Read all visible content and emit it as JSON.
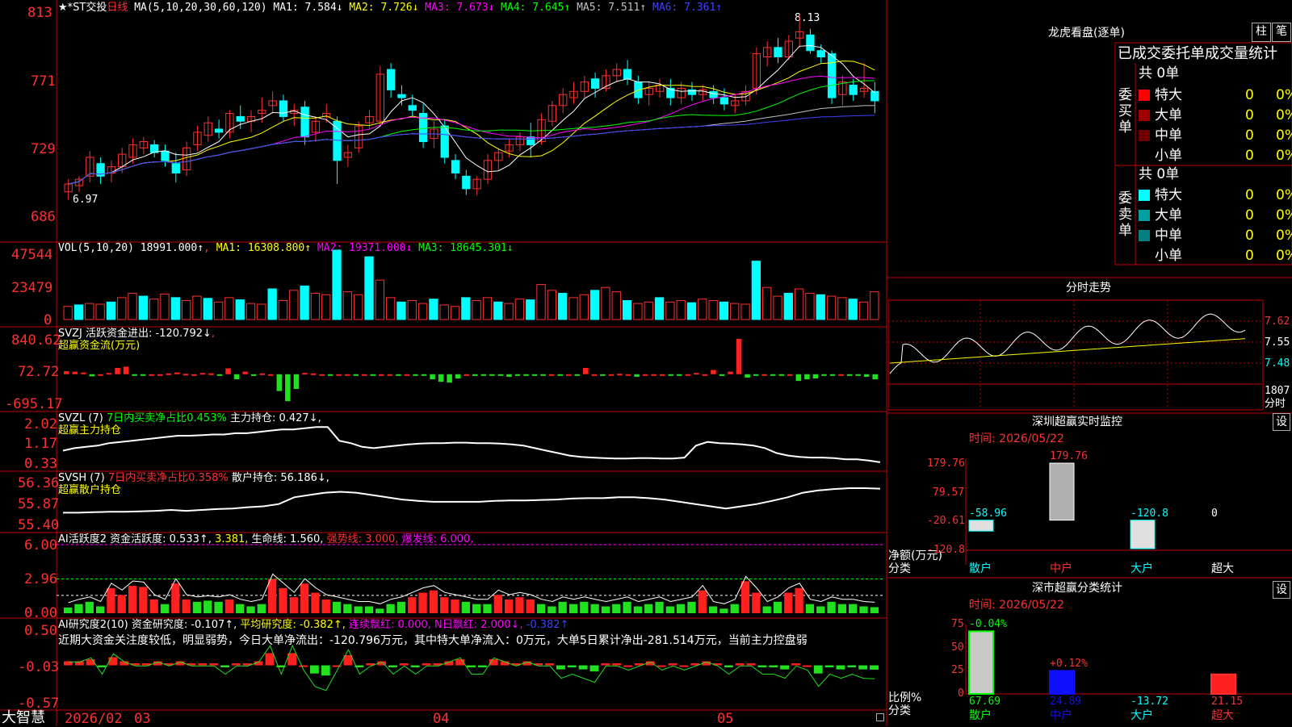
{
  "stock_title": "★*ST交投",
  "period": "日线",
  "ma_panel": {
    "label": "MA(5,10,20,30,60,120)",
    "items": [
      {
        "text": "MA1: 7.584↓",
        "color": "#ffffff"
      },
      {
        "text": "MA2: 7.726↓",
        "color": "#ffff00"
      },
      {
        "text": "MA3: 7.673↓",
        "color": "#ff00ff"
      },
      {
        "text": "MA4: 7.645↑",
        "color": "#00ff00"
      },
      {
        "text": "MA5: 7.511↑",
        "color": "#c0c0c0"
      },
      {
        "text": "MA6: 7.361↑",
        "color": "#4040ff"
      }
    ],
    "high_marker": "8.13",
    "low_marker": "6.97",
    "y_ticks": [
      "813",
      "771",
      "729",
      "686"
    ]
  },
  "vol_panel": {
    "label": "VOL(5,10,20)",
    "value": "18991.000↑",
    "items": [
      {
        "text": "MA1: 16308.800↑",
        "color": "#ffff00"
      },
      {
        "text": "MA2: 19371.000↓",
        "color": "#ff00ff"
      },
      {
        "text": "MA3: 18645.301↓",
        "color": "#00ff00"
      }
    ],
    "y_ticks": [
      "47544",
      "23479",
      "0"
    ]
  },
  "svzj_panel": {
    "label": "SVZJ",
    "line1": "活跃资金进出: -120.792↓",
    "line2": "超赢资金流(万元)",
    "y_ticks": [
      "840.62",
      "72.72",
      "-695.17"
    ]
  },
  "svzl_panel": {
    "label": "SVZL (7)",
    "ratio": "7日内买卖净占比0.453%",
    "holding": "主力持仓: 0.427↓,",
    "line2": "超赢主力持仓",
    "y_ticks": [
      "2.02",
      "1.17",
      "0.33"
    ]
  },
  "svsh_panel": {
    "label": "SVSH (7)",
    "ratio": "7日内买卖净占比0.358%",
    "holding": "散户持仓: 56.186↓,",
    "line2": "超赢散户持仓",
    "y_ticks": [
      "56.36",
      "55.87",
      "55.40"
    ]
  },
  "ai_active_panel": {
    "label": "AI活跃度2",
    "v1": "资金活跃度: 0.533↑,",
    "v2": "3.381,",
    "v3": "生命线: 1.560,",
    "v4": "强势线: 3.000,",
    "v5": "爆发线: 6.000,",
    "y_ticks": [
      "6.00",
      "2.96",
      "0.00"
    ]
  },
  "ai_research_panel": {
    "label": "AI研究度2(10)",
    "v1": "资金研究度: -0.107↑,",
    "v2": "平均研究度: -0.382↑,",
    "v3": "连续飘红: 0.000,",
    "v4": "N日飘红: 2.000↓,",
    "v5": "-0.382↑",
    "commentary": "近期大资金关注度较低，明显弱势，今日大单净流出：-120.796万元，其中特大单净流入：0万元，大单5日累计净出-281.514万元，当前主力控盘弱",
    "y_ticks": [
      "0.50",
      "-0.03",
      "-0.57"
    ]
  },
  "bottom_bar": {
    "brand": "大智慧",
    "dates": [
      "2026/02",
      "03",
      "04",
      "05"
    ]
  },
  "right_panel": {
    "dragon_title": "龙虎看盘(逐单)",
    "btn_bar": "柱",
    "btn_pen": "笔",
    "tabs": [
      "已成交",
      "委托单",
      "成交量统计"
    ],
    "buy_group": {
      "label": "委买单",
      "total": "共 0单",
      "rows": [
        {
          "name": "特大",
          "count": "0",
          "pct": "0%",
          "color": "#ff0000"
        },
        {
          "name": "大单",
          "count": "0",
          "pct": "0%",
          "color": "#a00000"
        },
        {
          "name": "中单",
          "count": "0",
          "pct": "0%",
          "color": "#700000"
        },
        {
          "name": "小单",
          "count": "0",
          "pct": "0%",
          "color": ""
        }
      ]
    },
    "sell_group": {
      "label": "委卖单",
      "total": "共 0单",
      "rows": [
        {
          "name": "特大",
          "count": "0",
          "pct": "0%",
          "color": "#00ffff"
        },
        {
          "name": "大单",
          "count": "0",
          "pct": "0%",
          "color": "#00a0a0"
        },
        {
          "name": "中单",
          "count": "0",
          "pct": "0%",
          "color": "#008080"
        },
        {
          "name": "小单",
          "count": "0",
          "pct": "0%",
          "color": ""
        }
      ]
    },
    "intraday": {
      "title": "分时走势",
      "y_ticks": [
        "7.62",
        "7.55",
        "7.48"
      ],
      "vol_tick": "1807",
      "vol_label": "分时"
    },
    "monitor": {
      "title": "深圳超赢实时监控",
      "btn": "设",
      "time_label": "时间:",
      "time": "2026/05/22",
      "y_ticks": [
        "179.76",
        "79.57",
        "-20.61",
        "-120.8"
      ],
      "y_label": "净额(万元)",
      "x_label": "分类",
      "categories": [
        "散户",
        "中户",
        "大户",
        "超大"
      ],
      "values": [
        -58.96,
        179.76,
        -120.8,
        0
      ],
      "value_labels": [
        "-58.96",
        "179.76",
        "-120.8",
        "0"
      ]
    },
    "stats": {
      "title": "深市超赢分类统计",
      "btn": "设",
      "time_label": "时间:",
      "time": "2026/05/22",
      "y_ticks": [
        "75",
        "50",
        "25",
        "0"
      ],
      "y_label": "比例%",
      "x_label": "分类",
      "categories": [
        "散户",
        "中户",
        "大户",
        "超大"
      ],
      "values": [
        67.69,
        24.89,
        -13.72,
        21.15
      ],
      "value_labels": [
        "67.69",
        "24.89",
        "-13.72",
        "21.15"
      ],
      "change_labels": [
        "-0.04%",
        "+0.12%",
        "",
        ""
      ]
    }
  },
  "chart_data": [
    {
      "type": "candlestick",
      "title": "★*ST交投 日线",
      "ylim": [
        6.86,
        8.13
      ],
      "high": 8.13,
      "low": 6.97,
      "x_ticks": [
        "2026/02",
        "03",
        "04",
        "05"
      ],
      "ohlc": [
        [
          7.0,
          7.08,
          6.95,
          7.05
        ],
        [
          7.04,
          7.1,
          7.0,
          7.08
        ],
        [
          7.1,
          7.26,
          7.06,
          7.22
        ],
        [
          7.18,
          7.22,
          7.05,
          7.1
        ],
        [
          7.12,
          7.2,
          7.06,
          7.16
        ],
        [
          7.16,
          7.28,
          7.12,
          7.24
        ],
        [
          7.22,
          7.34,
          7.18,
          7.3
        ],
        [
          7.28,
          7.35,
          7.24,
          7.32
        ],
        [
          7.3,
          7.33,
          7.22,
          7.25
        ],
        [
          7.26,
          7.3,
          7.16,
          7.2
        ],
        [
          7.18,
          7.25,
          7.06,
          7.12
        ],
        [
          7.14,
          7.32,
          7.1,
          7.28
        ],
        [
          7.3,
          7.42,
          7.26,
          7.38
        ],
        [
          7.36,
          7.48,
          7.32,
          7.44
        ],
        [
          7.4,
          7.46,
          7.34,
          7.38
        ],
        [
          7.38,
          7.52,
          7.34,
          7.5
        ],
        [
          7.48,
          7.55,
          7.4,
          7.45
        ],
        [
          7.45,
          7.52,
          7.38,
          7.48
        ],
        [
          7.5,
          7.6,
          7.44,
          7.52
        ],
        [
          7.55,
          7.64,
          7.5,
          7.58
        ],
        [
          7.58,
          7.62,
          7.45,
          7.48
        ],
        [
          7.5,
          7.56,
          7.42,
          7.52
        ],
        [
          7.54,
          7.58,
          7.3,
          7.35
        ],
        [
          7.38,
          7.48,
          7.32,
          7.45
        ],
        [
          7.48,
          7.56,
          7.44,
          7.5
        ],
        [
          7.45,
          7.48,
          7.05,
          7.2
        ],
        [
          7.22,
          7.3,
          7.16,
          7.25
        ],
        [
          7.28,
          7.45,
          7.25,
          7.42
        ],
        [
          7.44,
          7.52,
          7.4,
          7.48
        ],
        [
          7.45,
          7.8,
          7.42,
          7.75
        ],
        [
          7.78,
          7.82,
          7.6,
          7.65
        ],
        [
          7.62,
          7.68,
          7.55,
          7.6
        ],
        [
          7.55,
          7.62,
          7.48,
          7.52
        ],
        [
          7.5,
          7.56,
          7.28,
          7.32
        ],
        [
          7.34,
          7.45,
          7.28,
          7.4
        ],
        [
          7.42,
          7.46,
          7.18,
          7.22
        ],
        [
          7.2,
          7.24,
          7.08,
          7.12
        ],
        [
          7.1,
          7.14,
          6.98,
          7.02
        ],
        [
          7.02,
          7.1,
          6.98,
          7.08
        ],
        [
          7.08,
          7.24,
          7.05,
          7.2
        ],
        [
          7.2,
          7.28,
          7.14,
          7.25
        ],
        [
          7.26,
          7.34,
          7.22,
          7.3
        ],
        [
          7.3,
          7.38,
          7.26,
          7.35
        ],
        [
          7.35,
          7.44,
          7.22,
          7.3
        ],
        [
          7.32,
          7.5,
          7.3,
          7.46
        ],
        [
          7.45,
          7.58,
          7.42,
          7.55
        ],
        [
          7.55,
          7.66,
          7.5,
          7.62
        ],
        [
          7.6,
          7.7,
          7.56,
          7.64
        ],
        [
          7.64,
          7.74,
          7.6,
          7.7
        ],
        [
          7.72,
          7.76,
          7.6,
          7.66
        ],
        [
          7.66,
          7.78,
          7.64,
          7.74
        ],
        [
          7.74,
          7.82,
          7.7,
          7.78
        ],
        [
          7.78,
          7.84,
          7.68,
          7.72
        ],
        [
          7.7,
          7.74,
          7.56,
          7.6
        ],
        [
          7.62,
          7.7,
          7.55,
          7.66
        ],
        [
          7.64,
          7.72,
          7.6,
          7.68
        ],
        [
          7.66,
          7.72,
          7.55,
          7.6
        ],
        [
          7.6,
          7.7,
          7.56,
          7.66
        ],
        [
          7.65,
          7.7,
          7.58,
          7.62
        ],
        [
          7.62,
          7.68,
          7.58,
          7.65
        ],
        [
          7.64,
          7.68,
          7.56,
          7.6
        ],
        [
          7.6,
          7.66,
          7.52,
          7.56
        ],
        [
          7.55,
          7.62,
          7.5,
          7.58
        ],
        [
          7.58,
          7.68,
          7.55,
          7.64
        ],
        [
          7.66,
          7.92,
          7.62,
          7.88
        ],
        [
          7.86,
          7.96,
          7.8,
          7.92
        ],
        [
          7.92,
          7.98,
          7.82,
          7.86
        ],
        [
          7.86,
          8.0,
          7.84,
          7.96
        ],
        [
          7.98,
          8.13,
          7.92,
          8.02
        ],
        [
          8.0,
          8.04,
          7.88,
          7.9
        ],
        [
          7.9,
          7.94,
          7.82,
          7.86
        ],
        [
          7.88,
          7.9,
          7.56,
          7.6
        ],
        [
          7.62,
          7.74,
          7.55,
          7.7
        ],
        [
          7.68,
          7.72,
          7.58,
          7.62
        ],
        [
          7.64,
          7.82,
          7.6,
          7.66
        ],
        [
          7.64,
          7.7,
          7.5,
          7.58
        ]
      ]
    },
    {
      "type": "bar",
      "title": "VOL(5,10,20)",
      "ylim": [
        0,
        47544
      ],
      "values": [
        9000,
        10000,
        11000,
        10500,
        12000,
        15000,
        18000,
        16000,
        14000,
        17500,
        15000,
        13000,
        16000,
        14500,
        12000,
        15000,
        13500,
        11000,
        10500,
        21000,
        13000,
        20000,
        23000,
        18000,
        17000,
        47544,
        19000,
        17000,
        43000,
        27000,
        15000,
        12000,
        13000,
        11000,
        14000,
        10000,
        9000,
        15000,
        13000,
        15000,
        12000,
        11000,
        14000,
        13500,
        24000,
        20000,
        18000,
        15000,
        17000,
        20000,
        22000,
        19000,
        13000,
        11000,
        12000,
        15000,
        12000,
        13000,
        11500,
        14000,
        13000,
        12000,
        11000,
        10500,
        40000,
        22000,
        16000,
        18000,
        21000,
        18000,
        17000,
        16000,
        15000,
        14000,
        12000,
        18991
      ]
    },
    {
      "type": "bar",
      "title": "SVZJ 超赢资金流(万元)",
      "ylim": [
        -695.17,
        840.62
      ],
      "values": [
        72,
        60,
        40,
        -50,
        0,
        30,
        150,
        180,
        -20,
        -10,
        0,
        0,
        20,
        40,
        10,
        0,
        30,
        20,
        -30,
        140,
        -120,
        60,
        -40,
        20,
        0,
        -400,
        -640,
        -350,
        30,
        20,
        0,
        -10,
        0,
        0,
        -15,
        0,
        -20,
        0,
        0,
        -20,
        0,
        -30,
        -20,
        -120,
        -180,
        -200,
        -100,
        0,
        -40,
        -30,
        -20,
        -10,
        -60,
        -30,
        -20,
        -10,
        -10,
        0,
        -20,
        0,
        -30,
        150,
        0,
        -20,
        0,
        10,
        0,
        -60,
        0,
        0,
        0,
        -35,
        -20,
        0,
        30,
        0,
        100,
        -40,
        60,
        840,
        -80,
        -30,
        0,
        -20,
        -10,
        0,
        -160,
        -120,
        -100,
        -30,
        -10,
        0,
        -20,
        -15,
        -60,
        -121
      ]
    },
    {
      "type": "line",
      "title": "SVZL 主力持仓",
      "ylim": [
        0.33,
        2.02
      ],
      "values": [
        0.9,
        1.0,
        1.05,
        1.1,
        1.2,
        1.25,
        1.3,
        1.35,
        1.4,
        1.45,
        1.5,
        1.5,
        1.52,
        1.55,
        1.55,
        1.6,
        1.6,
        1.65,
        1.7,
        1.75,
        1.75,
        1.8,
        1.85,
        1.85,
        1.3,
        1.2,
        1.05,
        1.0,
        1.05,
        1.1,
        1.15,
        1.18,
        1.2,
        1.2,
        1.22,
        1.22,
        1.2,
        1.2,
        1.18,
        1.15,
        1.1,
        1.0,
        0.9,
        0.8,
        0.7,
        0.65,
        0.62,
        0.6,
        0.58,
        0.58,
        0.6,
        0.6,
        0.58,
        0.58,
        0.62,
        1.1,
        1.25,
        1.2,
        1.18,
        1.15,
        1.1,
        1.0,
        0.8,
        0.7,
        0.65,
        0.62,
        0.62,
        0.6,
        0.55,
        0.55,
        0.5,
        0.43
      ]
    },
    {
      "type": "line",
      "title": "SVSH 散户持仓",
      "ylim": [
        55.4,
        56.36
      ],
      "values": [
        55.66,
        55.66,
        55.67,
        55.68,
        55.68,
        55.69,
        55.7,
        55.72,
        55.7,
        55.72,
        55.74,
        55.75,
        55.78,
        55.8,
        55.85,
        56.0,
        56.05,
        56.1,
        56.12,
        56.1,
        56.05,
        56.0,
        55.95,
        55.92,
        55.9,
        55.9,
        55.9,
        55.9,
        55.92,
        55.93,
        55.93,
        55.94,
        55.95,
        55.97,
        55.98,
        55.98,
        56.0,
        56.0,
        55.98,
        55.95,
        55.9,
        55.85,
        55.8,
        55.75,
        55.8,
        55.85,
        55.92,
        56.0,
        56.1,
        56.15,
        56.18,
        56.2,
        56.2,
        56.19
      ]
    },
    {
      "type": "bar",
      "title": "AI活跃度2",
      "ylim": [
        0,
        6.0
      ],
      "reference_lines": {
        "生命线": 1.56,
        "强势线": 3.0,
        "爆发线": 6.0
      },
      "values": [
        0.5,
        0.8,
        1.0,
        0.6,
        2.2,
        1.6,
        2.4,
        2.3,
        1.2,
        0.8,
        2.6,
        1.2,
        1.0,
        1.1,
        1.0,
        1.2,
        0.8,
        0.6,
        0.8,
        3.0,
        2.2,
        1.4,
        2.6,
        1.8,
        1.2,
        1.0,
        0.8,
        0.6,
        0.6,
        0.4,
        0.8,
        1.0,
        1.4,
        1.8,
        2.0,
        1.4,
        1.2,
        1.0,
        0.8,
        0.8,
        1.6,
        1.2,
        1.4,
        1.2,
        0.8,
        0.6,
        1.0,
        0.8,
        1.0,
        0.8,
        0.6,
        0.8,
        1.0,
        0.6,
        0.8,
        1.0,
        0.6,
        0.8,
        1.0,
        2.0,
        0.6,
        0.4,
        0.8,
        2.8,
        1.8,
        0.6,
        1.0,
        1.8,
        2.2,
        0.8,
        0.6,
        1.0,
        0.8,
        0.8,
        0.6,
        0.533
      ]
    },
    {
      "type": "bar",
      "title": "AI研究度2(10)",
      "ylim": [
        -0.57,
        0.5
      ],
      "values": [
        0.1,
        0.1,
        0.15,
        -0.05,
        0.2,
        0.1,
        0.05,
        0.05,
        0.1,
        0.05,
        0.1,
        0.05,
        0.05,
        0.05,
        -0.05,
        0.05,
        0.05,
        0.1,
        0.3,
        -0.05,
        0.3,
        0.0,
        -0.2,
        -0.25,
        0.0,
        0.25,
        -0.05,
        0.05,
        0.1,
        -0.05,
        0.05,
        -0.05,
        0.05,
        0.05,
        0.1,
        0.15,
        -0.05,
        -0.05,
        0.15,
        0.1,
        0.05,
        0.1,
        0.05,
        0.05,
        -0.1,
        -0.05,
        -0.1,
        -0.15,
        0.05,
        0.05,
        0.0,
        0.05,
        0.1,
        0.0,
        0.05,
        0.0,
        0.05,
        0.1,
        0.05,
        -0.05,
        0.05,
        0.05,
        -0.05,
        -0.05,
        -0.1,
        0.05,
        0.0,
        -0.2,
        -0.05,
        -0.1,
        -0.05,
        -0.1,
        -0.107
      ]
    },
    {
      "type": "bar",
      "title": "深圳超赢实时监控",
      "categories": [
        "散户",
        "中户",
        "大户",
        "超大"
      ],
      "values": [
        -58.96,
        179.76,
        -120.8,
        0
      ],
      "ylabel": "净额(万元)",
      "ylim": [
        -120.8,
        179.76
      ]
    },
    {
      "type": "bar",
      "title": "深市超赢分类统计",
      "categories": [
        "散户",
        "中户",
        "大户",
        "超大"
      ],
      "values": [
        67.69,
        24.89,
        -13.72,
        21.15
      ],
      "ylabel": "比例%",
      "ylim": [
        0,
        75
      ]
    }
  ]
}
